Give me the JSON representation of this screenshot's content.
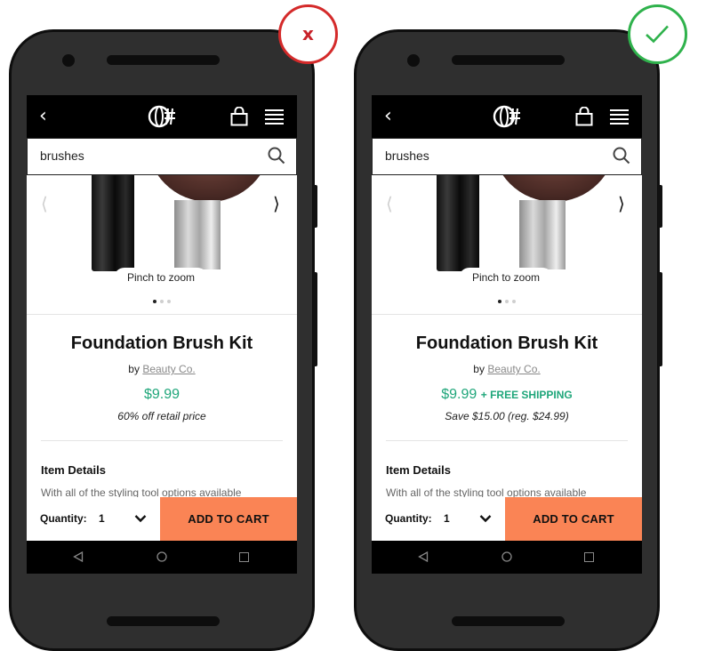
{
  "phones": [
    {
      "search": {
        "value": "brushes"
      },
      "zoom_hint": "Pinch to zoom",
      "product": {
        "title": "Foundation Brush Kit",
        "by_prefix": "by",
        "brand": "Beauty Co.",
        "price": "$9.99",
        "shipping": "",
        "savings": "60% off retail price"
      },
      "details": {
        "heading": "Item Details",
        "text": "With all of the styling tool options available"
      },
      "cart": {
        "quantity_label": "Quantity:",
        "quantity_value": "1",
        "add_to_cart": "ADD TO CART"
      },
      "badge": {
        "text": "x",
        "color": "#d42a2a"
      }
    },
    {
      "search": {
        "value": "brushes"
      },
      "zoom_hint": "Pinch to zoom",
      "product": {
        "title": "Foundation Brush Kit",
        "by_prefix": "by",
        "brand": "Beauty Co.",
        "price": "$9.99",
        "shipping": "+ FREE SHIPPING",
        "savings": "Save $15.00 (reg. $24.99)"
      },
      "details": {
        "heading": "Item Details",
        "text": "With all of the styling tool options available"
      },
      "cart": {
        "quantity_label": "Quantity:",
        "quantity_value": "1",
        "add_to_cart": "ADD TO CART"
      },
      "badge": {
        "text": "",
        "icon": "check-icon",
        "color": "#2fb24c"
      }
    }
  ],
  "colors": {
    "price_green": "#1fa67a",
    "cta_orange": "#fa8455",
    "bar_black": "#000000"
  }
}
